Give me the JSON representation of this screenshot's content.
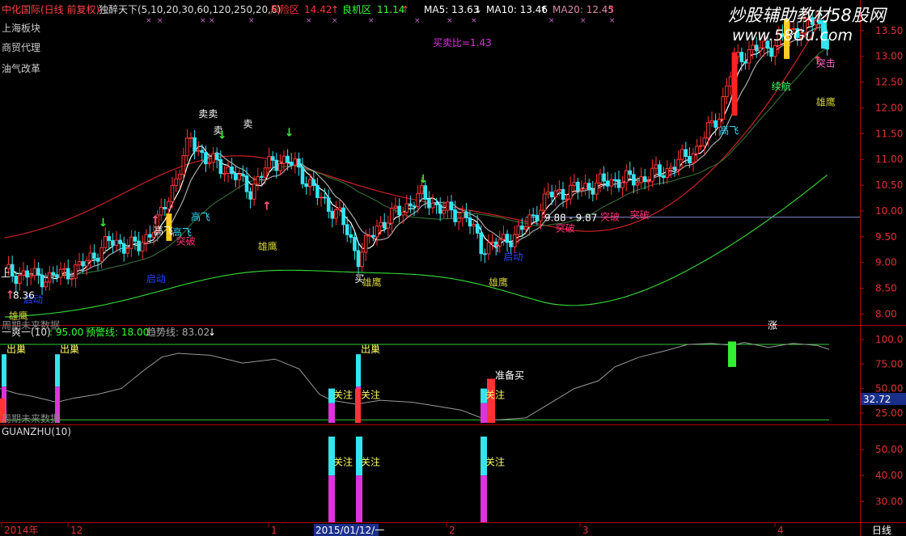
{
  "header": {
    "stock": "中化国际(日线 前复权)",
    "indicator": "独醉天下(5,10,20,30,60,120,250,20,6)",
    "risk_label": "风险区",
    "risk_value": "14.42",
    "chance_label": "良机区",
    "chance_value": "11.14",
    "ma5": "MA5: 13.63",
    "ma10": "MA10: 13.46",
    "ma20": "MA20: 12.45",
    "watermark": "炒股辅助教材58股网",
    "watermark_url": "www.58Gu.com"
  },
  "sectors": [
    "上海板块",
    "商贸代理",
    "油气改革"
  ],
  "main_chart": {
    "buy_sell_ratio": "买卖比=1.43",
    "price_axis": [
      "13.50",
      "13.00",
      "12.50",
      "12.00",
      "11.50",
      "11.00",
      "10.50",
      "10.00",
      "9.50",
      "9.00",
      "8.50",
      "8.00"
    ],
    "price_min": 7.85,
    "price_max": 13.78,
    "current_line": 9.88,
    "low_label": "8.36",
    "marker_left": "上",
    "no_data_note": "周期未来数据",
    "annotations": [
      {
        "text": "卖卖",
        "color": "#ffffff",
        "x_idx": 52,
        "price": 11.82
      },
      {
        "text": "卖",
        "color": "#ffffff",
        "x_idx": 56,
        "price": 11.5
      },
      {
        "text": "卖",
        "color": "#ffffff",
        "x_idx": 64,
        "price": 11.62
      },
      {
        "text": "高飞",
        "color": "#33ddff",
        "x_idx": 50,
        "price": 9.82
      },
      {
        "text": "高飞",
        "color": "#33ddff",
        "x_idx": 45,
        "price": 9.52
      },
      {
        "text": "高飞",
        "color": "#ffffff",
        "x_idx": 40,
        "price": 9.55
      },
      {
        "text": "突破",
        "color": "#ff3377",
        "x_idx": 46,
        "price": 9.35
      },
      {
        "text": "雄鹰",
        "color": "#cccc33",
        "x_idx": 68,
        "price": 9.25
      },
      {
        "text": "买",
        "color": "#ffffff",
        "x_idx": 94,
        "price": 8.62
      },
      {
        "text": "雄鹰",
        "color": "#cccc33",
        "x_idx": 96,
        "price": 8.55
      },
      {
        "text": "雄鹰",
        "color": "#cccc33",
        "x_idx": 130,
        "price": 8.55
      },
      {
        "text": "启动",
        "color": "#2244ff",
        "x_idx": 134,
        "price": 9.05
      },
      {
        "text": "启动",
        "color": "#2244ff",
        "x_idx": 38,
        "price": 8.62
      },
      {
        "text": "启动",
        "color": "#2244ff",
        "x_idx": 5,
        "price": 8.22
      },
      {
        "text": "雄鹰",
        "color": "#cccc33",
        "x_idx": 1,
        "price": 7.9
      },
      {
        "text": "9.88 - 9.87",
        "color": "#ffffff",
        "x_idx": 145,
        "price": 9.8
      },
      {
        "text": "突破",
        "color": "#ff3377",
        "x_idx": 148,
        "price": 9.6
      },
      {
        "text": "突破",
        "color": "#ff3377",
        "x_idx": 160,
        "price": 9.82
      },
      {
        "text": "突破",
        "color": "#ff3377",
        "x_idx": 168,
        "price": 9.86
      },
      {
        "text": "高飞",
        "color": "#33ddff",
        "x_idx": 192,
        "price": 11.5
      },
      {
        "text": "续航",
        "color": "#33ff66",
        "x_idx": 206,
        "price": 12.35
      },
      {
        "text": "雄鹰",
        "color": "#cccc33",
        "x_idx": 218,
        "price": 12.05
      },
      {
        "text": "突击",
        "color": "#ff66cc",
        "x_idx": 218,
        "price": 12.8
      },
      {
        "text": "涨",
        "color": "#ffffff",
        "x_idx": 205,
        "price": 7.72
      }
    ]
  },
  "panel2": {
    "title": "一爽一(10)",
    "v1": ": 95.00",
    "v2": "预警线: 18.00",
    "v3": "趋势线: 83.02",
    "axis": [
      "100.0",
      "75.00",
      "50.00",
      "25.00"
    ],
    "current": "32.72",
    "labels": {
      "out1": "出巢",
      "out2": "出巢",
      "out3": "出巢",
      "attention": "关注",
      "ready": "准备买",
      "no_data": "周期未来数据"
    }
  },
  "panel3": {
    "title": "GUANZHU(10)",
    "axis": [
      "50.00",
      "40.00",
      "30.00"
    ],
    "attention": "关注"
  },
  "time_axis": {
    "labels": [
      "2014年",
      "12",
      "1",
      "2015/01/12/一",
      "2",
      "3",
      "4"
    ],
    "period": "日线"
  },
  "colors": {
    "up": "#ff3333",
    "down": "#33e5f0",
    "axis_red": "#b00000",
    "ma_upper": "#cc2222",
    "ma_lower": "#33cc33"
  }
}
